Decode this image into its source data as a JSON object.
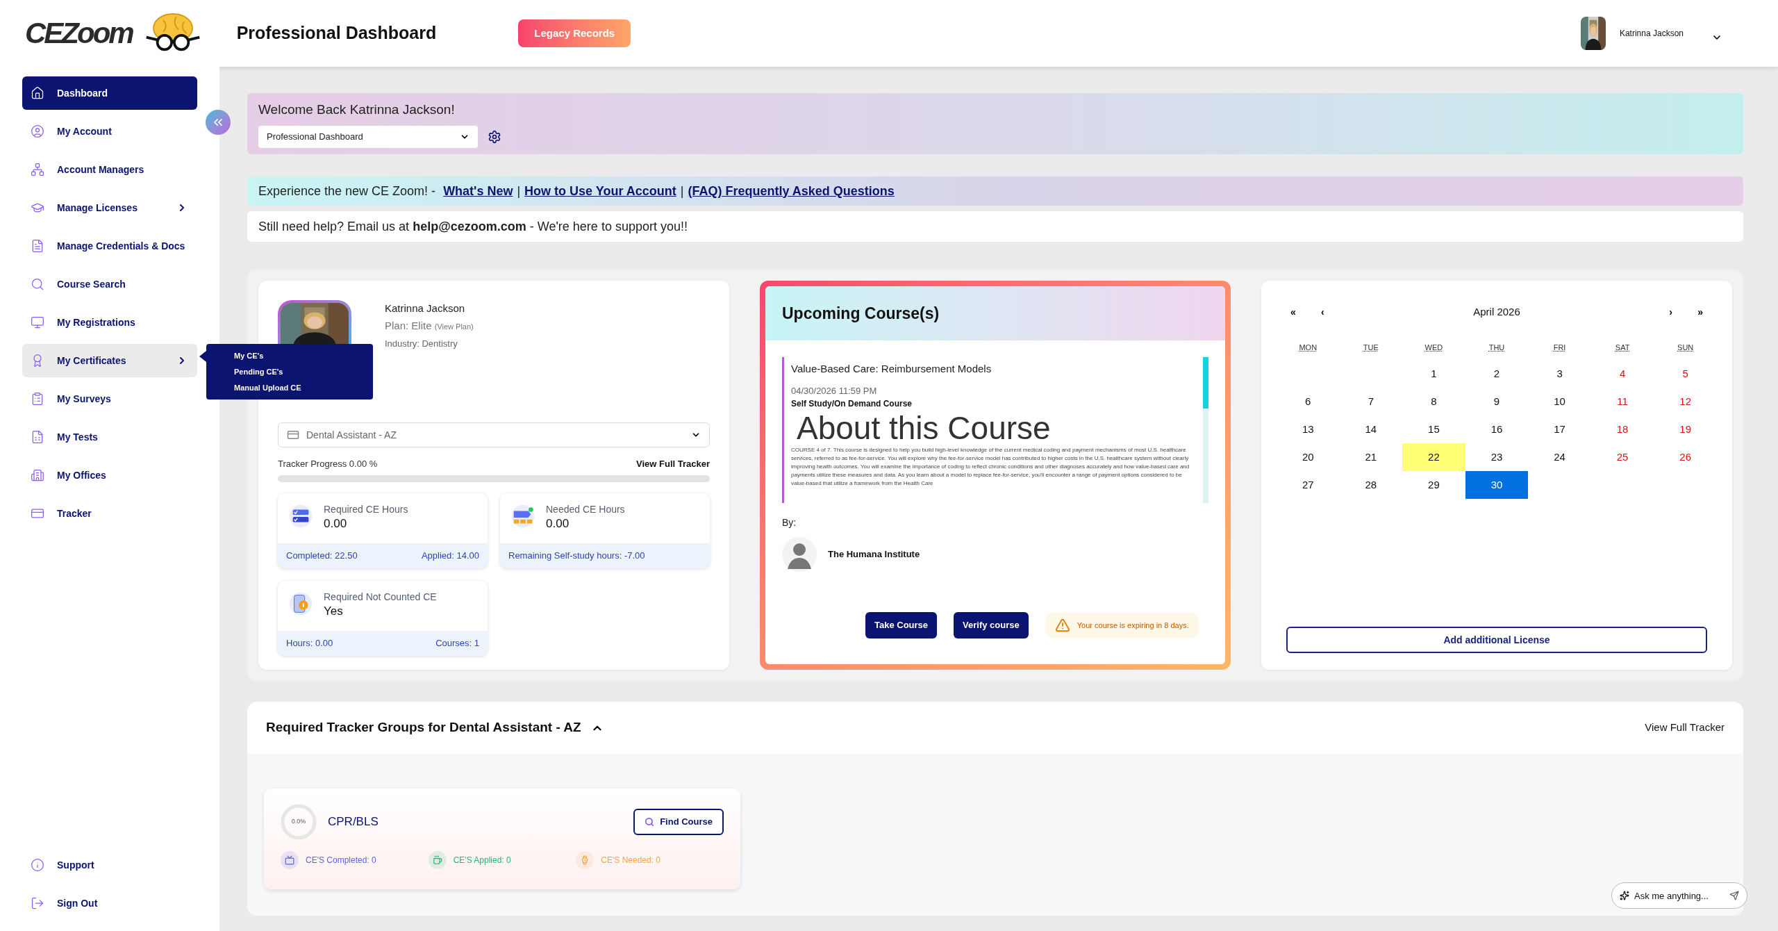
{
  "header": {
    "logo": "CEZoom",
    "title": "Professional Dashboard",
    "legacy_button": "Legacy Records",
    "user_name": "Katrinna Jackson"
  },
  "sidebar": {
    "items": [
      {
        "label": "Dashboard",
        "selected": true,
        "expandable": false
      },
      {
        "label": "My Account",
        "selected": false,
        "expandable": false
      },
      {
        "label": "Account Managers",
        "selected": false,
        "expandable": false
      },
      {
        "label": "Manage Licenses",
        "selected": false,
        "expandable": true
      },
      {
        "label": "Manage Credentials & Docs",
        "selected": false,
        "expandable": false
      },
      {
        "label": "Course Search",
        "selected": false,
        "expandable": false
      },
      {
        "label": "My Registrations",
        "selected": false,
        "expandable": false
      },
      {
        "label": "My Certificates",
        "selected": false,
        "expandable": true,
        "hovered": true,
        "flyout": [
          "My CE's",
          "Pending CE's",
          "Manual Upload CE"
        ]
      },
      {
        "label": "My Surveys",
        "selected": false,
        "expandable": false
      },
      {
        "label": "My Tests",
        "selected": false,
        "expandable": false
      },
      {
        "label": "My Offices",
        "selected": false,
        "expandable": false
      },
      {
        "label": "Tracker",
        "selected": false,
        "expandable": false
      }
    ],
    "bottom_items": [
      {
        "label": "Support"
      },
      {
        "label": "Sign Out"
      }
    ]
  },
  "welcome": {
    "text": "Welcome Back Katrinna Jackson!",
    "dashboard_select": "Professional Dashboard"
  },
  "announcement": {
    "text": "Experience the new CE Zoom! - ",
    "links": [
      "What's New",
      "How to Use Your Account",
      "(FAQ) Frequently Asked Questions"
    ],
    "separator": "|"
  },
  "help": {
    "text": "Still need help? Email us at **help@cezoom.com** - We're here to support you!!"
  },
  "profile": {
    "name": "Katrinna Jackson",
    "plan": "Plan: Elite",
    "view_plan": "(View Plan)",
    "industry": "Industry: Dentistry",
    "license_select": "Dental Assistant - AZ",
    "progress_label": "Tracker Progress 0.00 %",
    "progress_link": "View Full Tracker",
    "progress": {
      "level": 0
    },
    "stats": [
      {
        "title": "Required CE Hours",
        "value": "0.00",
        "footer": [
          "Completed: 22.50",
          "Applied: 14.00"
        ]
      },
      {
        "title": "Needed CE Hours",
        "value": "0.00",
        "footer": [
          "Remaining Self-study hours: -7.00"
        ]
      },
      {
        "title": "Required Not Counted CE",
        "value": "Yes",
        "footer": [
          "Hours: 0.00",
          "Courses: 1"
        ]
      }
    ]
  },
  "upcoming": {
    "title": "Upcoming Course(s)",
    "course": {
      "title": "Value-Based Care: Reimbursement Models",
      "date": "04/30/2026 11:59 PM",
      "type": "Self Study/On Demand Course",
      "about_heading": "About this Course",
      "description": "COURSE 4 of 7. This course is designed to help you build high-level knowledge of the current medical coding and payment mechanisms of most U.S. healthcare services, referred to as fee-for-service. You will explore why the fee-for-service model has contributed to higher costs in the U.S. healthcare system without clearly improving health outcomes. You will examine the importance of coding to reflect chronic conditions and other diagnoses accurately and how value-based care and payments utilize these measures and data. As you learn about a model to replace fee-for-service, you'll encounter a range of payment options considered to be value-based that utilize a framework from the Health Care"
    },
    "by_label": "By:",
    "provider": "The Humana Institute",
    "buttons": [
      "Take Course",
      "Verify course"
    ],
    "warning": "Your course is expiring in 8 days."
  },
  "calendar": {
    "month": "April 2026",
    "nav": [
      "«",
      "‹",
      "›",
      "»"
    ],
    "weekdays": [
      "MON",
      "TUE",
      "WED",
      "THU",
      "FRI",
      "SAT",
      "SUN"
    ],
    "weeks": [
      [
        {
          "day": "1",
          "weekend": false,
          "today": false,
          "selected": false
        },
        {
          "day": "2",
          "weekend": false,
          "today": false,
          "selected": false
        },
        {
          "day": "3",
          "weekend": false,
          "today": false,
          "selected": false
        },
        {
          "day": "4",
          "weekend": true,
          "today": false,
          "selected": false
        },
        {
          "day": "5",
          "weekend": true,
          "today": false,
          "selected": false
        }
      ],
      [
        {
          "day": "6",
          "weekend": false,
          "today": false,
          "selected": false
        },
        {
          "day": "7",
          "weekend": false,
          "today": false,
          "selected": false
        },
        {
          "day": "8",
          "weekend": false,
          "today": false,
          "selected": false
        },
        {
          "day": "9",
          "weekend": false,
          "today": false,
          "selected": false
        },
        {
          "day": "10",
          "weekend": false,
          "today": false,
          "selected": false
        },
        {
          "day": "11",
          "weekend": true,
          "today": false,
          "selected": false
        },
        {
          "day": "12",
          "weekend": true,
          "today": false,
          "selected": false
        }
      ],
      [
        {
          "day": "13",
          "weekend": false,
          "today": false,
          "selected": false
        },
        {
          "day": "14",
          "weekend": false,
          "today": false,
          "selected": false
        },
        {
          "day": "15",
          "weekend": false,
          "today": false,
          "selected": false
        },
        {
          "day": "16",
          "weekend": false,
          "today": false,
          "selected": false
        },
        {
          "day": "17",
          "weekend": false,
          "today": false,
          "selected": false
        },
        {
          "day": "18",
          "weekend": true,
          "today": false,
          "selected": false
        },
        {
          "day": "19",
          "weekend": true,
          "today": false,
          "selected": false
        }
      ],
      [
        {
          "day": "20",
          "weekend": false,
          "today": false,
          "selected": false
        },
        {
          "day": "21",
          "weekend": false,
          "today": false,
          "selected": false
        },
        {
          "day": "22",
          "weekend": false,
          "today": true,
          "selected": false
        },
        {
          "day": "23",
          "weekend": false,
          "today": false,
          "selected": false
        },
        {
          "day": "24",
          "weekend": false,
          "today": false,
          "selected": false
        },
        {
          "day": "25",
          "weekend": true,
          "today": false,
          "selected": false
        },
        {
          "day": "26",
          "weekend": true,
          "today": false,
          "selected": false
        }
      ],
      [
        {
          "day": "27",
          "weekend": false,
          "today": false,
          "selected": false
        },
        {
          "day": "28",
          "weekend": false,
          "today": false,
          "selected": false
        },
        {
          "day": "29",
          "weekend": false,
          "today": false,
          "selected": false
        },
        {
          "day": "30",
          "weekend": false,
          "today": false,
          "selected": true
        }
      ]
    ],
    "add_button": "Add additional License"
  },
  "tracker_groups": {
    "title": "Required Tracker Groups for Dental Assistant - AZ",
    "expanded": true,
    "link": "View Full Tracker",
    "groups": [
      {
        "name": "CPR/BLS",
        "percent": "0.0%",
        "level": 0,
        "button": "Find Course",
        "stats": [
          {
            "label": "CE'S Completed: 0",
            "color": "#5b5fe0"
          },
          {
            "label": "CE'S Applied: 0",
            "color": "#22b573"
          },
          {
            "label": "CE'S Needed: 0",
            "color": "#f5a340"
          }
        ]
      }
    ]
  },
  "chat": {
    "placeholder": "Ask me anything..."
  }
}
